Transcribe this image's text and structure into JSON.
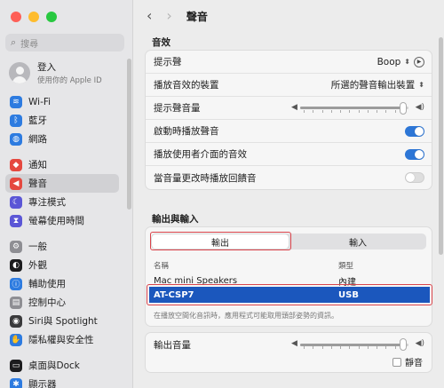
{
  "sidebar": {
    "search_placeholder": "搜尋",
    "account": {
      "name": "登入",
      "subtitle": "使用你的 Apple ID"
    },
    "items": [
      {
        "label": "Wi-Fi",
        "icon": "wifi-icon",
        "color": "#2d7be0"
      },
      {
        "label": "藍牙",
        "icon": "bluetooth-icon",
        "color": "#2d7be0"
      },
      {
        "label": "網路",
        "icon": "globe-icon",
        "color": "#2d7be0"
      },
      {
        "label": "通知",
        "icon": "bell-icon",
        "color": "#e5483f"
      },
      {
        "label": "聲音",
        "icon": "speaker-icon",
        "color": "#e5483f"
      },
      {
        "label": "專注模式",
        "icon": "moon-icon",
        "color": "#5b56d6"
      },
      {
        "label": "螢幕使用時間",
        "icon": "hourglass-icon",
        "color": "#5b56d6"
      },
      {
        "label": "一般",
        "icon": "gear-icon",
        "color": "#8e8e93"
      },
      {
        "label": "外觀",
        "icon": "appearance-icon",
        "color": "#1c1c1e"
      },
      {
        "label": "輔助使用",
        "icon": "accessibility-icon",
        "color": "#2d7be0"
      },
      {
        "label": "控制中心",
        "icon": "control-center-icon",
        "color": "#8e8e93"
      },
      {
        "label": "Siri與 Spotlight",
        "icon": "siri-icon",
        "color": "#3a3a3c"
      },
      {
        "label": "隱私權與安全性",
        "icon": "hand-icon",
        "color": "#2d7be0"
      },
      {
        "label": "桌面與Dock",
        "icon": "dock-icon",
        "color": "#1c1c1e"
      },
      {
        "label": "顯示器",
        "icon": "display-icon",
        "color": "#2d7be0"
      }
    ]
  },
  "toolbar": {
    "title": "聲音"
  },
  "effects": {
    "heading": "音效",
    "alert_label": "提示聲",
    "alert_value": "Boop",
    "device_label": "播放音效的裝置",
    "device_value": "所選的聲音輸出裝置",
    "alert_volume_label": "提示聲音量",
    "alert_volume_level": 0.95,
    "startup_label": "啟動時播放聲音",
    "startup_on": true,
    "ui_label": "播放使用者介面的音效",
    "ui_on": true,
    "feedback_label": "當音量更改時播放回饋音",
    "feedback_on": false
  },
  "io": {
    "heading": "輸出與輸入",
    "tab_output": "輸出",
    "tab_input": "輸入",
    "col_name": "名稱",
    "col_type": "類型",
    "devices": [
      {
        "name": "Mac mini Speakers",
        "type": "內建",
        "selected": false
      },
      {
        "name": "AT-CSP7",
        "type": "USB",
        "selected": true
      }
    ],
    "note": "在播放空間化音訊時，應用程式可能取用頭部姿勢的資訊。"
  },
  "output_volume": {
    "label": "輸出音量",
    "level": 0.95,
    "mute_label": "靜音"
  },
  "colors": {
    "accent": "#2d76d6",
    "selection": "#1b57bd",
    "highlight_box": "#d9434a"
  }
}
